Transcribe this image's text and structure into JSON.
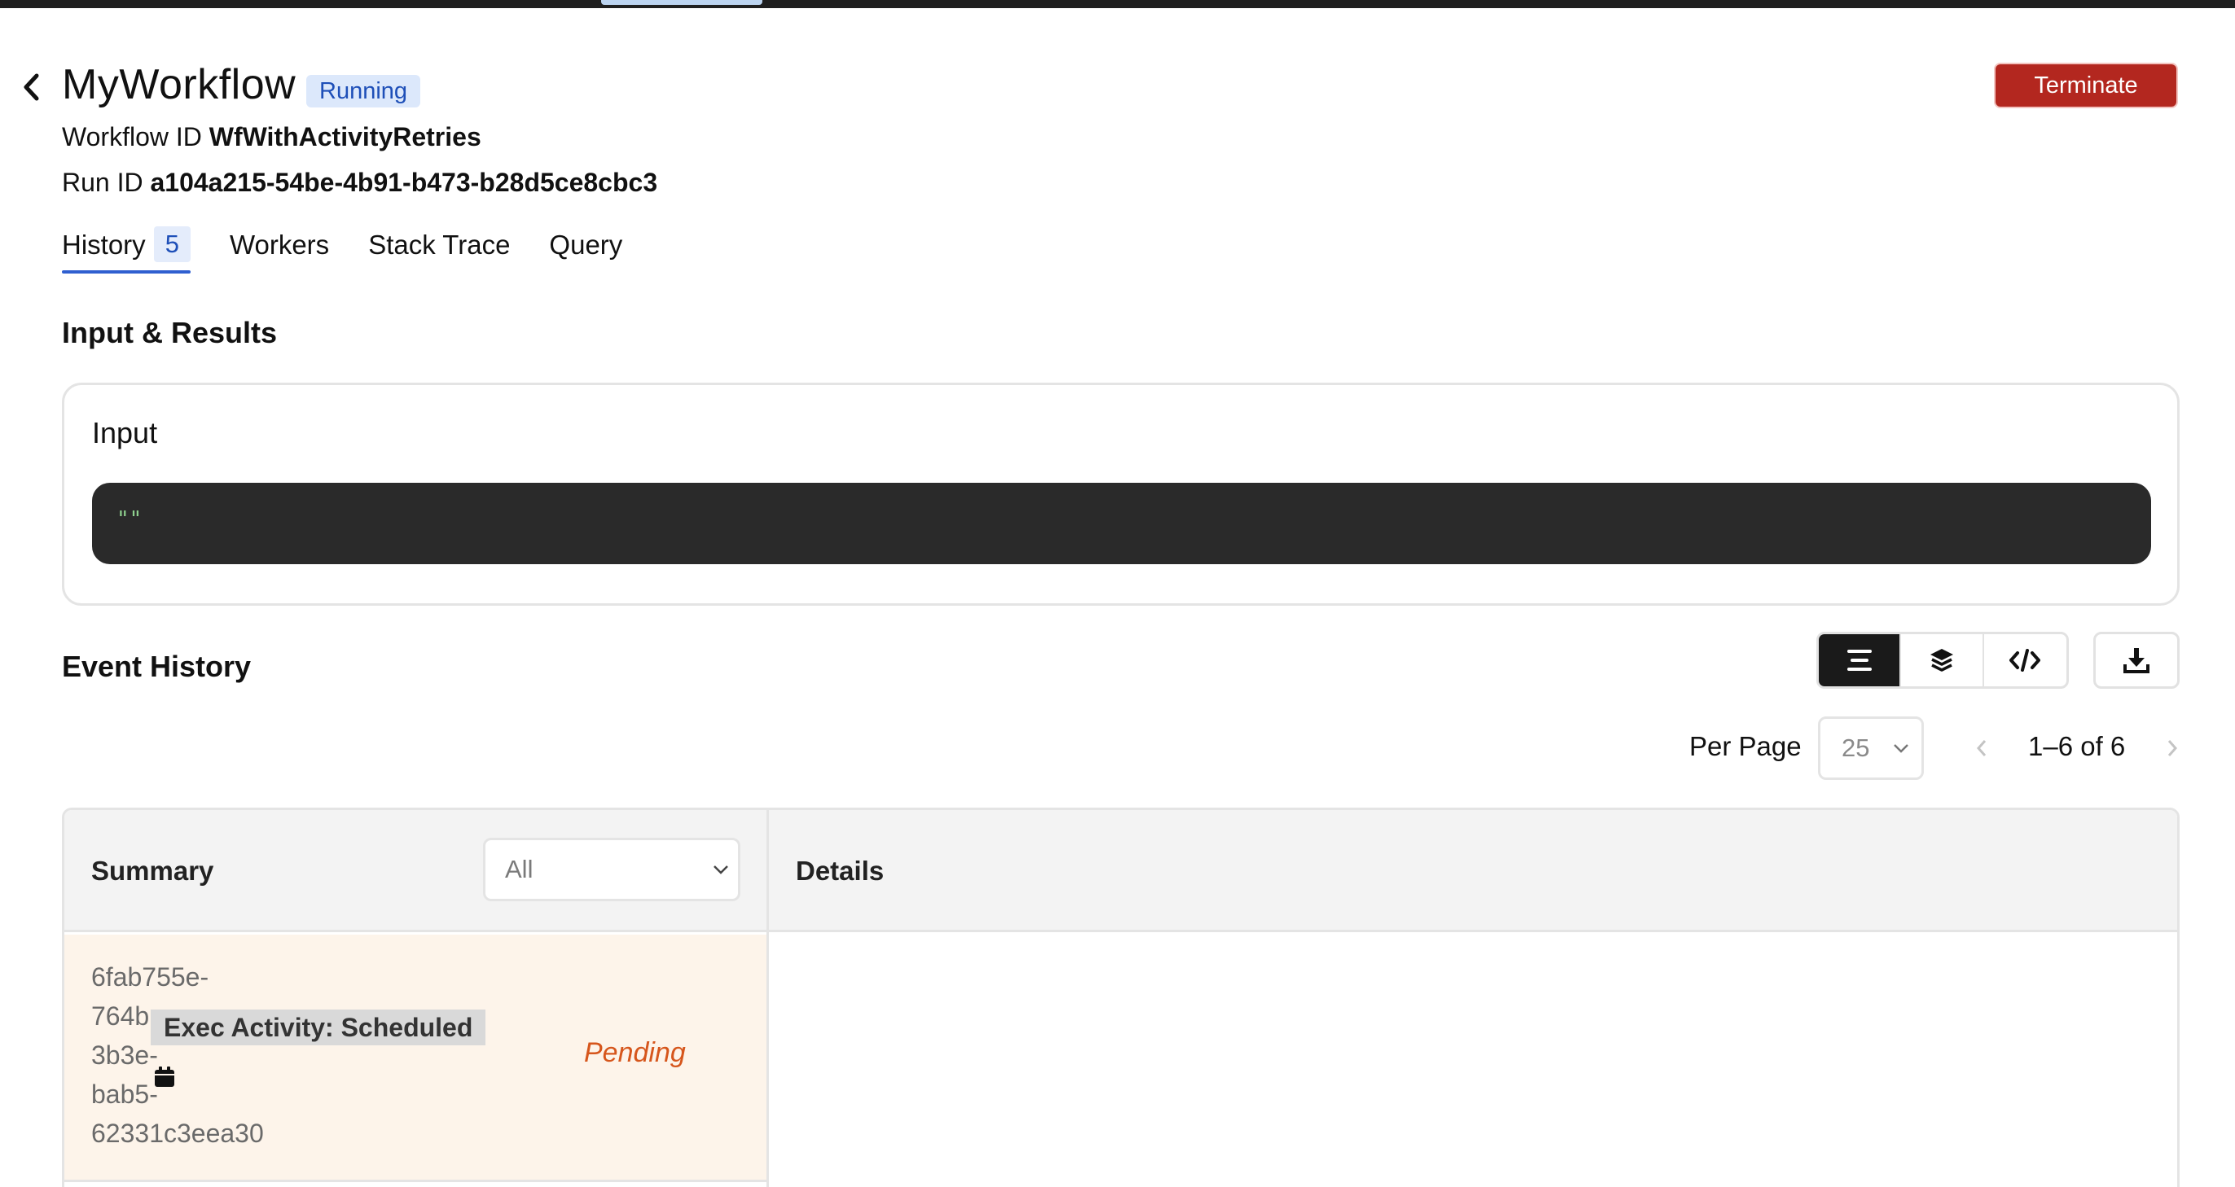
{
  "header": {
    "title": "MyWorkflow",
    "status": "Running",
    "terminate_label": "Terminate",
    "workflow_id_label": "Workflow ID",
    "workflow_id": "WfWithActivityRetries",
    "run_id_label": "Run ID",
    "run_id": "a104a215-54be-4b91-b473-b28d5ce8cbc3"
  },
  "tabs": [
    {
      "label": "History",
      "count": "5",
      "active": true
    },
    {
      "label": "Workers"
    },
    {
      "label": "Stack Trace"
    },
    {
      "label": "Query"
    }
  ],
  "input_results": {
    "title": "Input & Results",
    "input_label": "Input",
    "input_value": "\"\""
  },
  "event_history": {
    "title": "Event History",
    "view_modes": [
      "compact-view",
      "feed-view",
      "json-view"
    ],
    "per_page_label": "Per Page",
    "per_page_value": "25",
    "range": "1–6 of 6",
    "table": {
      "summary_header": "Summary",
      "filter_value": "All",
      "details_header": "Details",
      "rows": [
        {
          "id": "6fab755e-764b-3b3e-bab5-62331c3eea30",
          "id_lines": [
            "6fab755e-",
            "764b",
            "3b3e-",
            "bab5-",
            "62331c3eea30"
          ],
          "label": "Exec Activity: Scheduled",
          "status": "Pending"
        }
      ]
    }
  },
  "colors": {
    "accent": "#2f5fd0",
    "danger": "#b3271f",
    "pending": "#d6561c",
    "row_pending_bg": "#fdf4ea"
  }
}
